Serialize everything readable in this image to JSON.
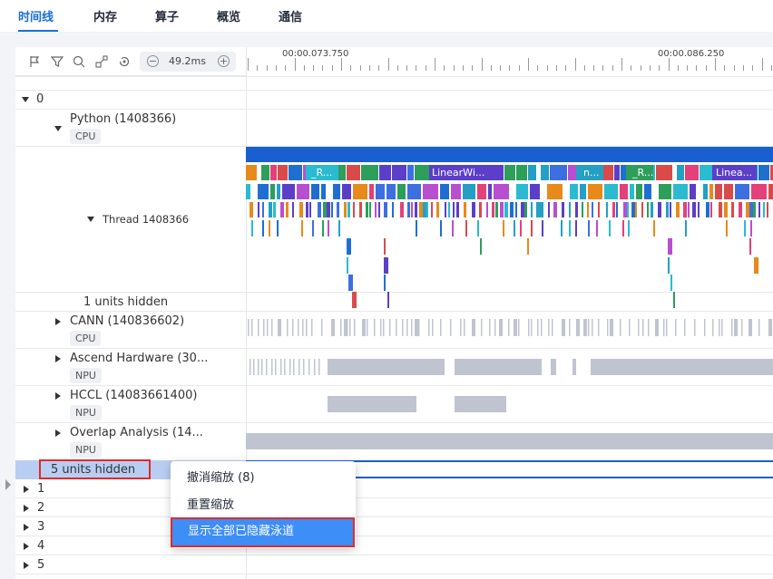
{
  "tabs": [
    {
      "label": "时间线",
      "active": true
    },
    {
      "label": "内存",
      "active": false
    },
    {
      "label": "算子",
      "active": false
    },
    {
      "label": "概览",
      "active": false
    },
    {
      "label": "通信",
      "active": false
    }
  ],
  "toolbar": {
    "icons": [
      "flag-icon",
      "filter-icon",
      "search-icon",
      "link-icon",
      "reset-icon"
    ],
    "zoom_minus": "−",
    "zoom_value": "49.2ms",
    "zoom_plus": "+"
  },
  "ruler": {
    "labels": [
      "00:00.073.750",
      "00:00.086.250"
    ]
  },
  "tree": {
    "root_label": "0",
    "python": {
      "label": "Python (1408366)",
      "badge": "CPU"
    },
    "thread": {
      "label": "Thread 1408366"
    },
    "units_hidden_1": "1 units hidden",
    "cann": {
      "label": "CANN (140836602)",
      "badge": "CPU"
    },
    "ascend": {
      "label": "Ascend Hardware (30...",
      "badge": "NPU"
    },
    "hccl": {
      "label": "HCCL (14083661400)",
      "badge": "NPU"
    },
    "overlap": {
      "label": "Overlap Analysis (14...",
      "badge": "NPU"
    },
    "units_hidden_5": "5 units hidden",
    "cards": [
      "1",
      "2",
      "3",
      "4",
      "5"
    ]
  },
  "slices": {
    "r1": "_R...",
    "linear1": "LinearWi...",
    "n1": "n...",
    "r2": "_R...",
    "linear2": "Linea..."
  },
  "context_menu": {
    "items": [
      "撤消缩放 (8)",
      "重置缩放",
      "显示全部已隐藏泳道"
    ],
    "highlighted_index": 2
  },
  "colors": {
    "accent": "#1a6fd6",
    "highlight": "#3d8ef7",
    "hidden_row": "#b9cdf3",
    "red_annotation": "#e02a2a",
    "gray_slice": "#bfc4d0"
  }
}
